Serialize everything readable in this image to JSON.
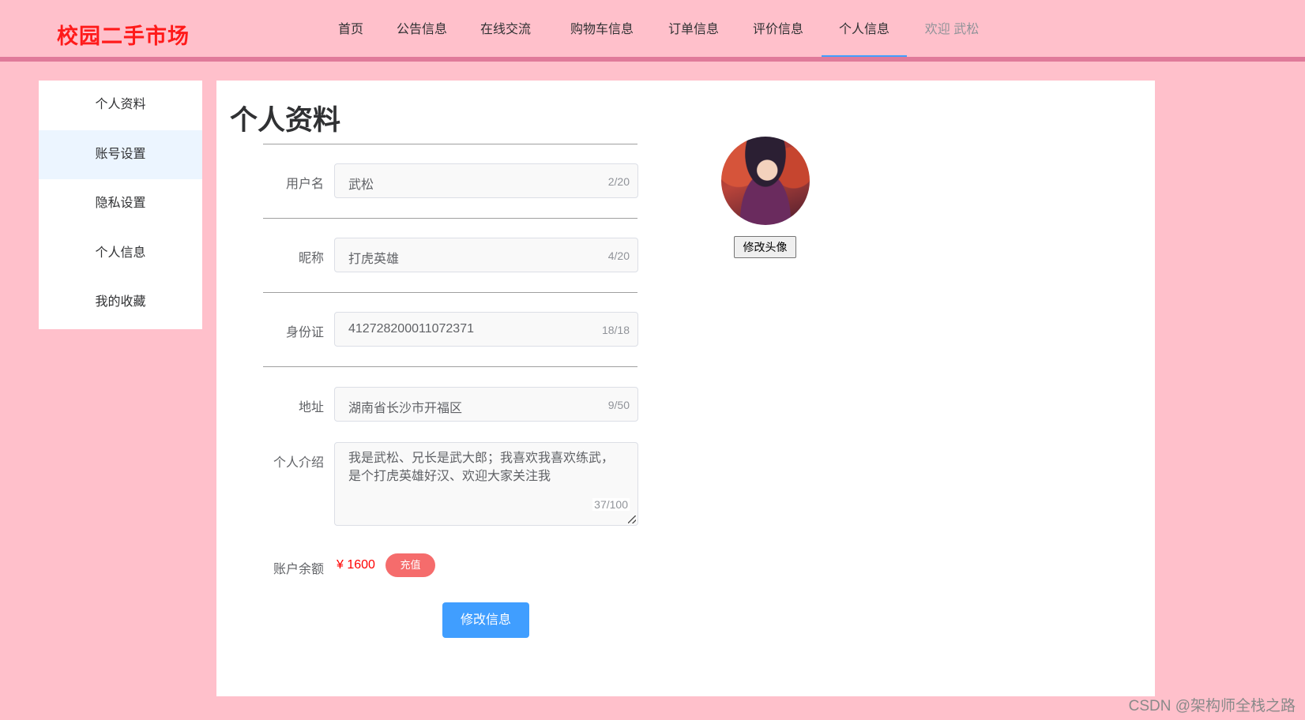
{
  "brand": "校园二手市场",
  "nav": {
    "items": [
      {
        "label": "首页"
      },
      {
        "label": "公告信息"
      },
      {
        "label": "在线交流"
      },
      {
        "label": "购物车信息"
      },
      {
        "label": "订单信息"
      },
      {
        "label": "评价信息"
      },
      {
        "label": "个人信息"
      }
    ],
    "active_index": 6,
    "welcome": "欢迎 武松"
  },
  "sidebar": {
    "items": [
      {
        "label": "个人资料"
      },
      {
        "label": "账号设置"
      },
      {
        "label": "隐私设置"
      },
      {
        "label": "个人信息"
      },
      {
        "label": "我的收藏"
      }
    ],
    "active_index": 1
  },
  "page_title": "个人资料",
  "form": {
    "username": {
      "label": "用户名",
      "value": "武松",
      "count": "2/20"
    },
    "nickname": {
      "label": "昵称",
      "value": "打虎英雄",
      "count": "4/20"
    },
    "id_card": {
      "label": "身份证",
      "value": "412728200011072371",
      "count": "18/18"
    },
    "address": {
      "label": "地址",
      "value": "湖南省长沙市开福区",
      "count": "9/50"
    },
    "intro": {
      "label": "个人介绍",
      "value": "我是武松、兄长是武大郎；我喜欢我喜欢练武，是个打虎英雄好汉、欢迎大家关注我",
      "count": "37/100"
    },
    "balance": {
      "label": "账户余额",
      "value": "¥ 1600",
      "recharge_label": "充值"
    },
    "submit_label": "修改信息"
  },
  "avatar": {
    "change_label": "修改头像"
  },
  "watermark": "CSDN @架构师全栈之路"
}
